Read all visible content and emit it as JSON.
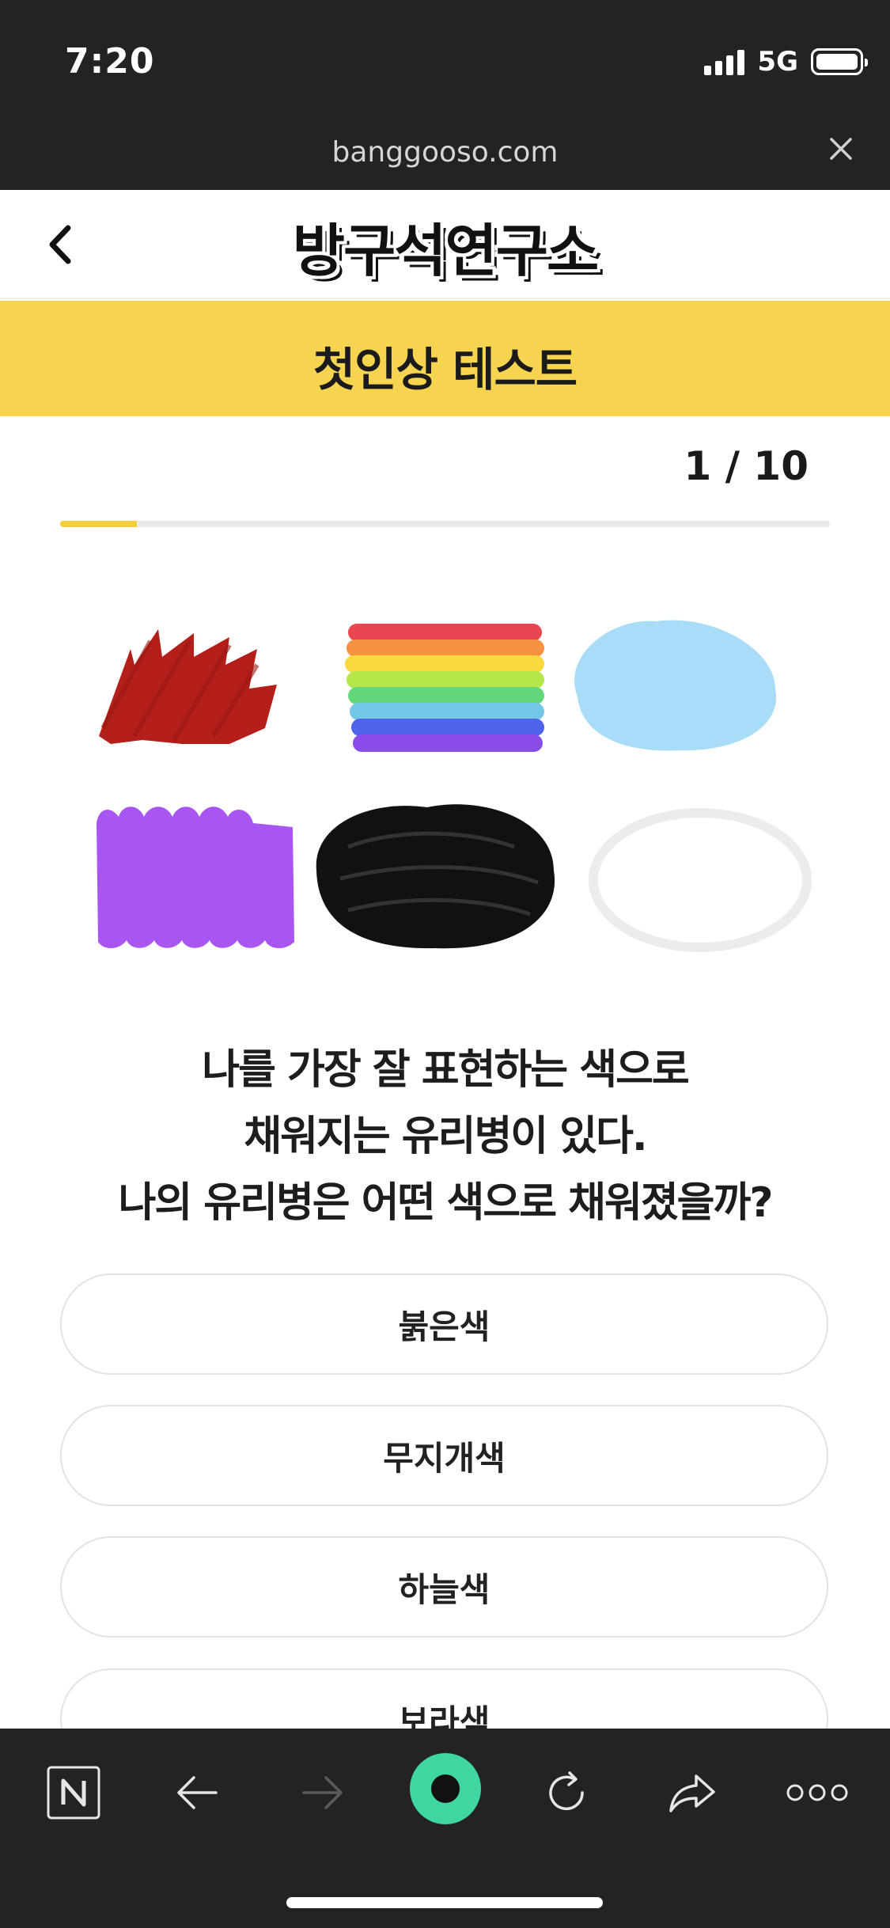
{
  "status_bar": {
    "time": "7:20",
    "network": "5G"
  },
  "browser": {
    "url": "banggooso.com"
  },
  "header": {
    "logo_text": "방구석연구소"
  },
  "title_band": {
    "title": "첫인상 테스트"
  },
  "progress": {
    "counter": "1 / 10",
    "fraction": 0.1
  },
  "question": {
    "lines": [
      "나를 가장 잘 표현하는 색으로",
      "채워지는 유리병이 있다.",
      "나의 유리병은 어떤 색으로 채워졌을까?"
    ]
  },
  "color_swatches": [
    {
      "name": "red",
      "color": "#b51f19"
    },
    {
      "name": "rainbow",
      "color": "#e94a4a"
    },
    {
      "name": "sky-blue",
      "color": "#a8dcf7"
    },
    {
      "name": "purple",
      "color": "#a855f2"
    },
    {
      "name": "black",
      "color": "#111111"
    },
    {
      "name": "white",
      "color": "#eeeeee"
    }
  ],
  "options": [
    {
      "label": "붉은색"
    },
    {
      "label": "무지개색"
    },
    {
      "label": "하늘색"
    },
    {
      "label": "보라색"
    }
  ],
  "toolbar": {
    "items": [
      "naver-icon",
      "back-arrow-icon",
      "forward-arrow-icon",
      "green-dot-icon",
      "refresh-icon",
      "share-icon",
      "more-icon"
    ],
    "accent": "#3fd6a0"
  }
}
